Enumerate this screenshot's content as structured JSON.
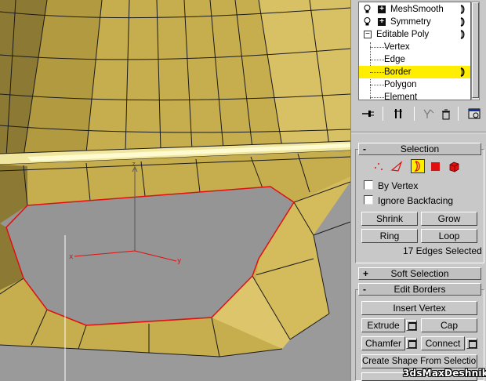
{
  "stack": {
    "items": [
      {
        "label": "MeshSmooth"
      },
      {
        "label": "Symmetry"
      },
      {
        "label": "Editable Poly"
      },
      {
        "label": "Vertex"
      },
      {
        "label": "Edge"
      },
      {
        "label": "Border"
      },
      {
        "label": "Polygon"
      },
      {
        "label": "Element"
      }
    ],
    "selected": "Border",
    "highlight_color": "#ffee00"
  },
  "toolbar": {
    "icons": [
      "pin-stack-icon",
      "show-end-result-icon",
      "make-unique-icon",
      "remove-modifier-icon",
      "configure-modifier-sets-icon"
    ]
  },
  "selection": {
    "title_sign": "-",
    "title": "Selection",
    "subobject_icons": [
      "vertex-icon",
      "edge-icon",
      "border-icon",
      "polygon-icon",
      "element-icon"
    ],
    "active_subobject": "border-icon",
    "by_vertex": "By Vertex",
    "ignore_backfacing": "Ignore Backfacing",
    "shrink": "Shrink",
    "grow": "Grow",
    "ring": "Ring",
    "loop": "Loop",
    "status": "17 Edges Selected"
  },
  "soft_selection": {
    "title_sign": "+",
    "title": "Soft Selection"
  },
  "edit_borders": {
    "title_sign": "-",
    "title": "Edit Borders",
    "insert_vertex": "Insert Vertex",
    "extrude": "Extrude",
    "cap": "Cap",
    "chamfer": "Chamfer",
    "connect": "Connect",
    "create_shape": "Create Shape From Selection"
  },
  "viewport": {
    "mesh_color": "#c4ac4c",
    "selection_color": "#e01010",
    "gizmo_axes": [
      "x",
      "y",
      "z"
    ]
  },
  "watermark": "3dsMaxDeshnik"
}
